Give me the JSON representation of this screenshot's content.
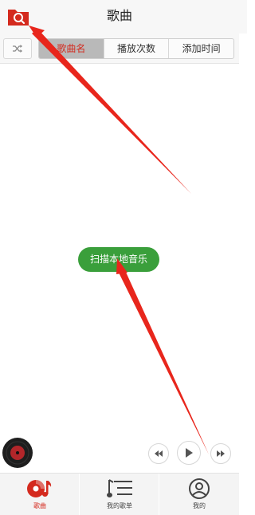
{
  "header": {
    "title": "歌曲"
  },
  "sort": {
    "tabs": [
      "歌曲名",
      "播放次数",
      "添加时间"
    ],
    "active_index": 0
  },
  "main": {
    "scan_button": "扫描本地音乐"
  },
  "nav": {
    "items": [
      {
        "label": "歌曲",
        "icon": "songs-icon",
        "active": true
      },
      {
        "label": "我的歌单",
        "icon": "playlist-icon",
        "active": false
      },
      {
        "label": "我的",
        "icon": "profile-icon",
        "active": false
      }
    ]
  },
  "colors": {
    "accent_red": "#d42a1e",
    "green": "#3a9f3b",
    "arrow": "#e8261c"
  }
}
